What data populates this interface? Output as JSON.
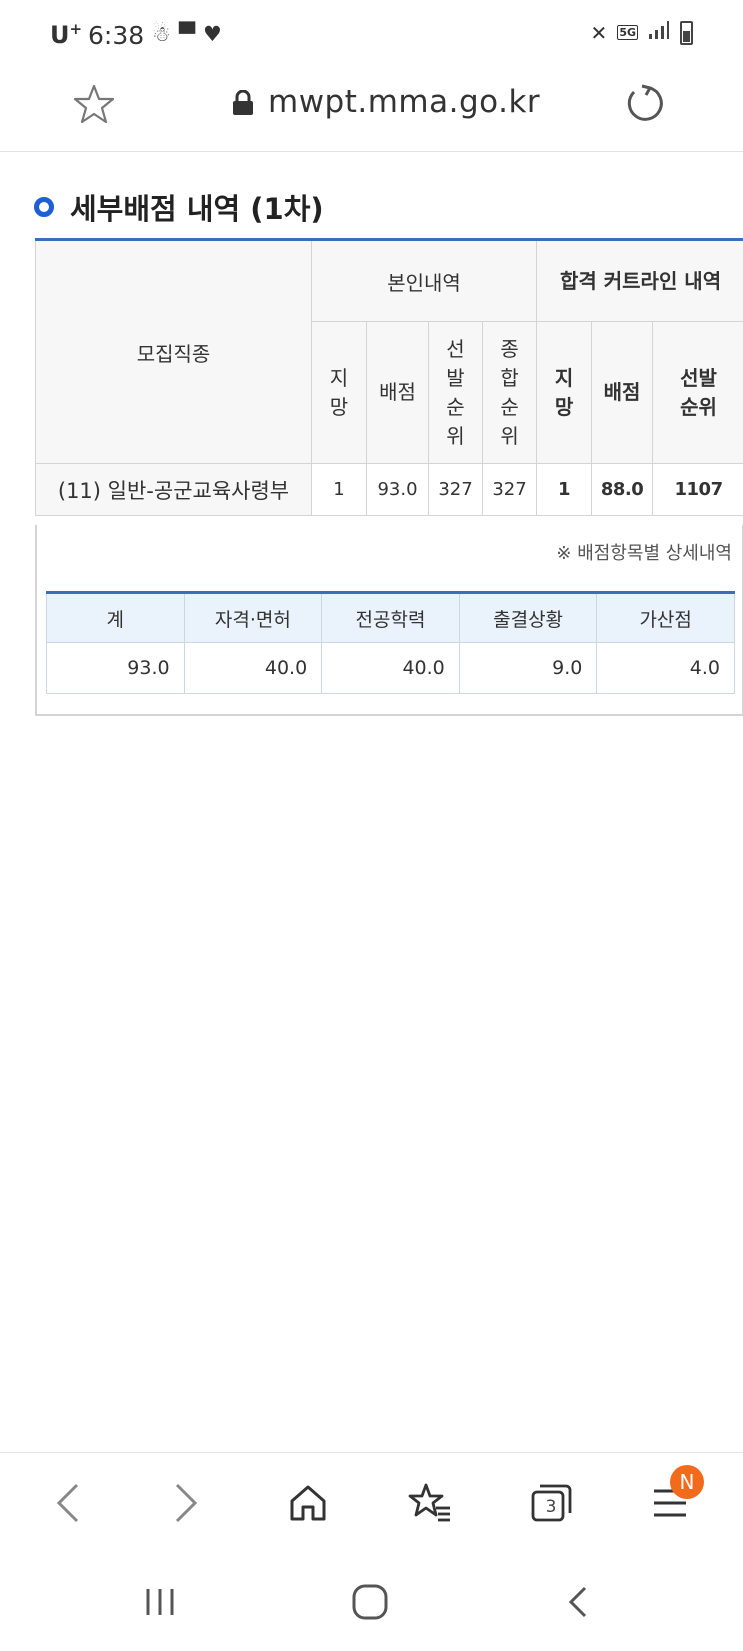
{
  "status_bar": {
    "carrier": "U",
    "carrier_sup": "+",
    "time": "6:38",
    "network_label": "5G"
  },
  "browser": {
    "url": "mwpt.mma.go.kr",
    "tab_count": "3",
    "notification_badge": "N"
  },
  "page": {
    "section_title": "세부배점 내역 (1차)",
    "table": {
      "col_recruit": "모집직종",
      "group_self": "본인내역",
      "group_cutoff": "합격 커트라인 내역",
      "self_headers": [
        "지망",
        "배점",
        "선발순위",
        "종합순위"
      ],
      "cutoff_headers": [
        "지망",
        "배점",
        "선발순위"
      ],
      "row": {
        "recruit": "(11) 일반-공군교육사령부",
        "self": [
          "1",
          "93.0",
          "327",
          "327"
        ],
        "cutoff": [
          "1",
          "88.0",
          "1107"
        ]
      }
    },
    "detail_note": "※ 배점항목별 상세내역",
    "detail_table": {
      "headers": [
        "계",
        "자격·면허",
        "전공학력",
        "출결상황",
        "가산점"
      ],
      "values": [
        "93.0",
        "40.0",
        "40.0",
        "9.0",
        "4.0"
      ]
    }
  },
  "colors": {
    "accent_blue": "#3c6cba",
    "cutoff_red": "#e0301e",
    "cutoff_value_blue": "#1b3f86",
    "badge_orange": "#f26a1b"
  }
}
